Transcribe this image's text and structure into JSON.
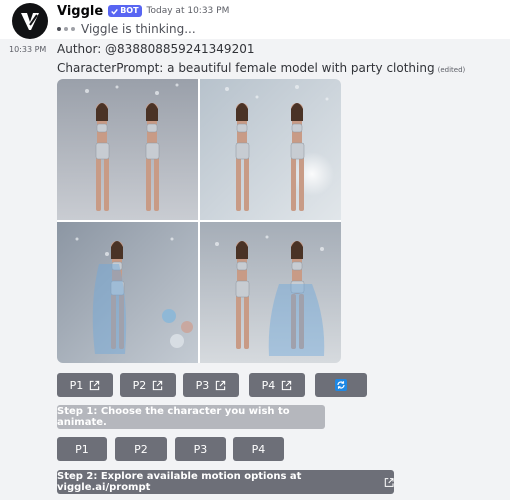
{
  "header": {
    "bot_name": "Viggle",
    "bot_badge": "BOT",
    "timestamp": "Today at 10:33 PM",
    "thinking_text": "Viggle is thinking..."
  },
  "message": {
    "side_time": "10:33 PM",
    "author": "Author: @838808859241349201",
    "prompt": "CharacterPrompt: a beautiful female model with party clothing",
    "edited": "(edited)"
  },
  "buttons_row1": [
    {
      "label": "P1"
    },
    {
      "label": "P2"
    },
    {
      "label": "P3"
    },
    {
      "label": "P4"
    }
  ],
  "step1_label": "Step 1: Choose the character you wish to animate.",
  "buttons_row2": [
    {
      "label": "P1"
    },
    {
      "label": "P2"
    },
    {
      "label": "P3"
    },
    {
      "label": "P4"
    }
  ],
  "step2_label": "Step 2: Explore available motion options at viggle.ai/prompt",
  "colors": {
    "button": "#6d6f78",
    "button_disabled": "#b5b7bd",
    "bot_badge": "#5865f2",
    "refresh_icon": "#1e88e5"
  }
}
